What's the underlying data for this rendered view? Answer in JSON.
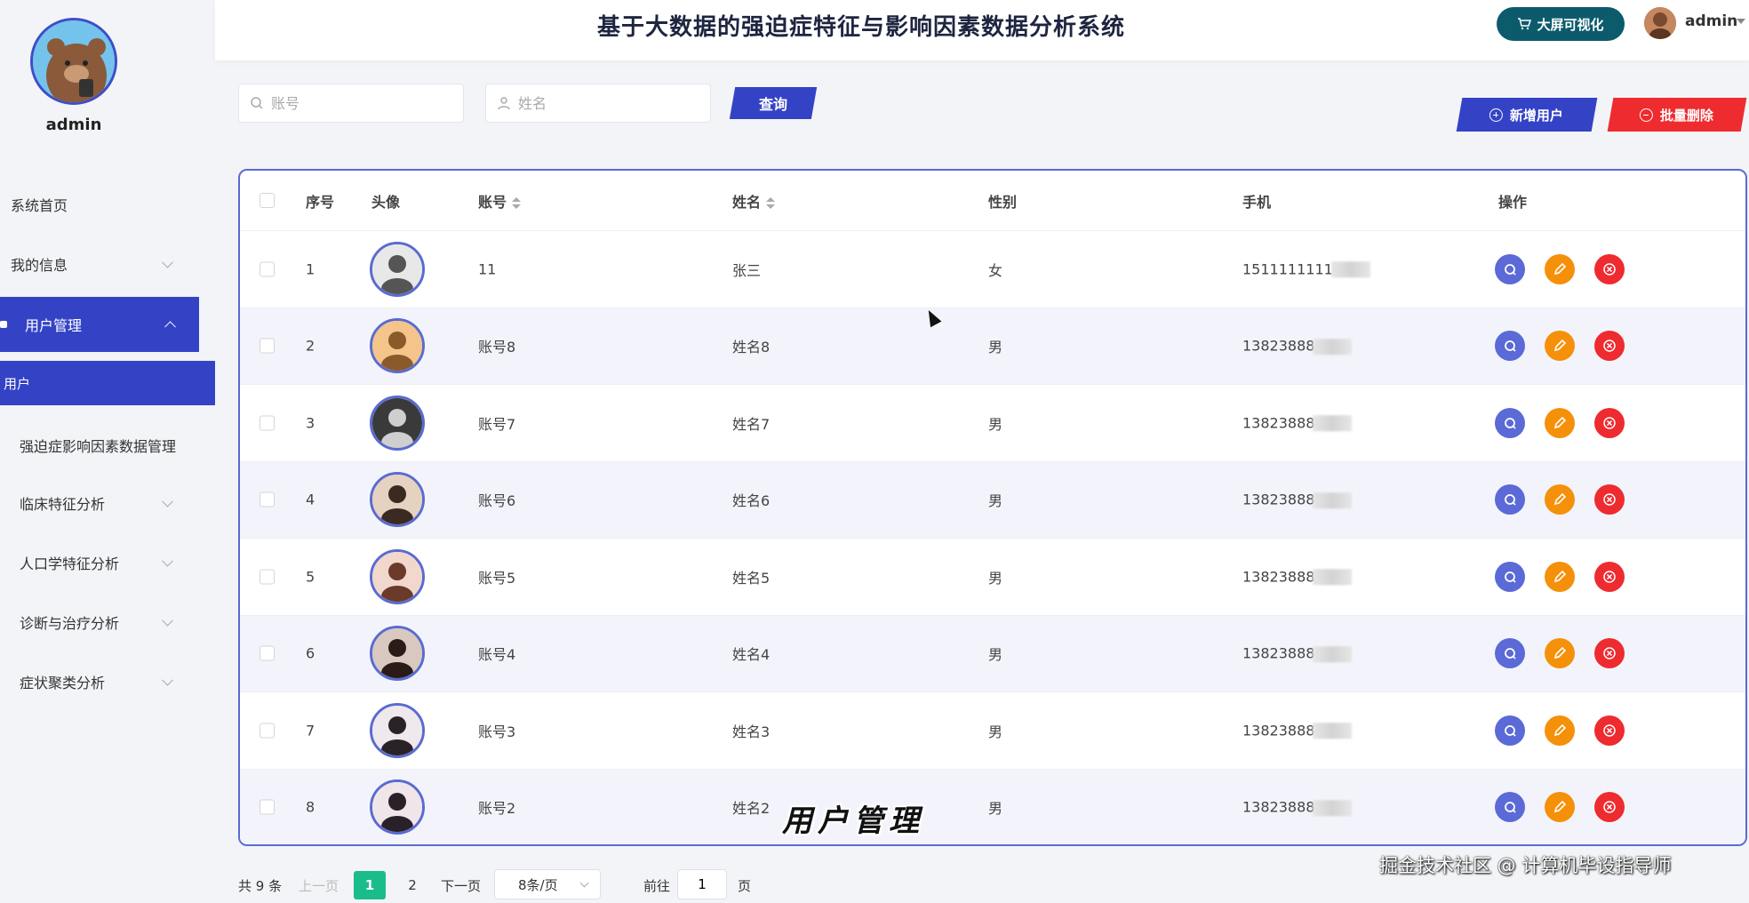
{
  "header": {
    "title": "基于大数据的强迫症特征与影响因素数据分析系统",
    "bigscreen_label": "大屏可视化",
    "user": "admin"
  },
  "sidebar": {
    "user": "admin",
    "items": [
      {
        "label": "系统首页"
      },
      {
        "label": "我的信息"
      },
      {
        "label": "用户管理"
      },
      {
        "label": "用户"
      },
      {
        "label": "强迫症影响因素数据管理"
      },
      {
        "label": "临床特征分析"
      },
      {
        "label": "人口学特征分析"
      },
      {
        "label": "诊断与治疗分析"
      },
      {
        "label": "症状聚类分析"
      }
    ]
  },
  "search": {
    "account_placeholder": "账号",
    "name_placeholder": "姓名",
    "query_label": "查询"
  },
  "actions": {
    "add_label": "新增用户",
    "batch_delete_label": "批量删除"
  },
  "table": {
    "headers": [
      "序号",
      "头像",
      "账号",
      "姓名",
      "性别",
      "手机",
      "操作"
    ],
    "rows": [
      {
        "no": "1",
        "account": "11",
        "name": "张三",
        "gender": "女",
        "phone": "1511111111"
      },
      {
        "no": "2",
        "account": "账号8",
        "name": "姓名8",
        "gender": "男",
        "phone": "13823888"
      },
      {
        "no": "3",
        "account": "账号7",
        "name": "姓名7",
        "gender": "男",
        "phone": "13823888"
      },
      {
        "no": "4",
        "account": "账号6",
        "name": "姓名6",
        "gender": "男",
        "phone": "13823888"
      },
      {
        "no": "5",
        "account": "账号5",
        "name": "姓名5",
        "gender": "男",
        "phone": "13823888"
      },
      {
        "no": "6",
        "account": "账号4",
        "name": "姓名4",
        "gender": "男",
        "phone": "13823888"
      },
      {
        "no": "7",
        "account": "账号3",
        "name": "姓名3",
        "gender": "男",
        "phone": "13823888"
      },
      {
        "no": "8",
        "account": "账号2",
        "name": "姓名2",
        "gender": "男",
        "phone": "13823888"
      }
    ]
  },
  "pagination": {
    "total": "共 9 条",
    "prev": "上一页",
    "page1": "1",
    "page2": "2",
    "next": "下一页",
    "page_size": "8条/页",
    "goto": "前往",
    "goto_value": "1",
    "page_unit": "页"
  },
  "overlay": {
    "caption": "用户管理",
    "watermark": "掘金技术社区 @ 计算机毕设指导师"
  },
  "colors": {
    "primary": "#3443c6",
    "danger": "#ee2b2f",
    "warning": "#f5900a",
    "success": "#1abc8c"
  }
}
